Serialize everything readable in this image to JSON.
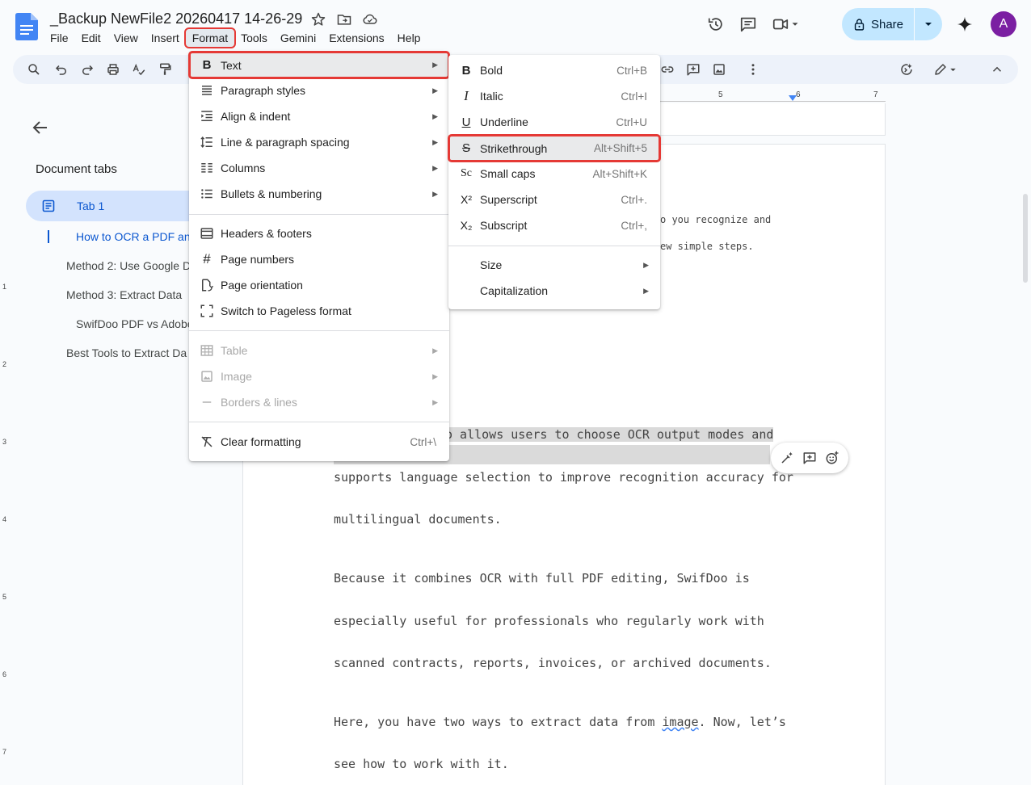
{
  "document": {
    "title": "_Backup NewFile2 20260417 14-26-29"
  },
  "menubar": {
    "items": [
      "File",
      "Edit",
      "View",
      "Insert",
      "Format",
      "Tools",
      "Gemini",
      "Extensions",
      "Help"
    ],
    "active": "Format"
  },
  "header": {
    "share_label": "Share",
    "avatar_initial": "A"
  },
  "ruler": {
    "marks": [
      "5",
      "6",
      "7"
    ]
  },
  "vertical_ruler": {
    "marks": [
      "1",
      "2",
      "3",
      "4",
      "5",
      "6",
      "7"
    ]
  },
  "sidebar": {
    "heading": "Document tabs",
    "tab_label": "Tab 1",
    "outline": [
      "How to OCR a PDF and",
      "Method 2: Use Google D",
      "Method 3: Extract Data",
      "SwifDoo PDF vs Adobe",
      "Best Tools to Extract Da"
    ]
  },
  "format_menu": {
    "items": [
      {
        "label": "Text",
        "icon": "bold-icon",
        "submenu": true
      },
      {
        "label": "Paragraph styles",
        "icon": "paragraph-styles-icon",
        "submenu": true
      },
      {
        "label": "Align & indent",
        "icon": "align-indent-icon",
        "submenu": true
      },
      {
        "label": "Line & paragraph spacing",
        "icon": "line-spacing-icon",
        "submenu": true
      },
      {
        "label": "Columns",
        "icon": "columns-icon",
        "submenu": true
      },
      {
        "label": "Bullets & numbering",
        "icon": "bullets-icon",
        "submenu": true
      },
      {
        "label": "Headers & footers",
        "icon": "headers-footers-icon"
      },
      {
        "label": "Page numbers",
        "icon": "hash-icon"
      },
      {
        "label": "Page orientation",
        "icon": "page-orientation-icon"
      },
      {
        "label": "Switch to Pageless format",
        "icon": "pageless-icon"
      },
      {
        "label": "Table",
        "icon": "table-icon",
        "submenu": true,
        "disabled": true
      },
      {
        "label": "Image",
        "icon": "image-icon",
        "submenu": true,
        "disabled": true
      },
      {
        "label": "Borders & lines",
        "icon": "borders-icon",
        "submenu": true,
        "disabled": true
      },
      {
        "label": "Clear formatting",
        "icon": "clear-formatting-icon",
        "shortcut": "Ctrl+\\"
      }
    ]
  },
  "text_menu": {
    "items": [
      {
        "label": "Bold",
        "glyph": "B",
        "shortcut": "Ctrl+B"
      },
      {
        "label": "Italic",
        "glyph": "I",
        "shortcut": "Ctrl+I"
      },
      {
        "label": "Underline",
        "glyph": "U",
        "shortcut": "Ctrl+U"
      },
      {
        "label": "Strikethrough",
        "glyph": "S",
        "shortcut": "Alt+Shift+5"
      },
      {
        "label": "Small caps",
        "glyph": "Sc",
        "shortcut": "Alt+Shift+K"
      },
      {
        "label": "Superscript",
        "glyph": "X²",
        "shortcut": "Ctrl+."
      },
      {
        "label": "Subscript",
        "glyph": "X₂",
        "shortcut": "Ctrl+,"
      },
      {
        "label": "Size",
        "submenu": true
      },
      {
        "label": "Capitalization",
        "submenu": true
      }
    ]
  },
  "body": {
    "small_line_1": "o you recognize and",
    "small_line_2": "ew simple steps.",
    "p1_line1": "o allows users to choose OCR output modes and",
    "p1_line2": "supports language selection to improve recognition accuracy for",
    "p1_line3": "multilingual documents.",
    "p2_line1": "Because it combines OCR with full PDF editing, SwifDoo is",
    "p2_line2": "especially useful for professionals who regularly work with",
    "p2_line3": "scanned contracts, reports, invoices, or archived documents.",
    "p3_line1_a": "Here, you have two ways to extract data from ",
    "p3_line1_b": "image",
    "p3_line1_c": ". Now, let’s",
    "p3_line2": "see how to work with it."
  }
}
